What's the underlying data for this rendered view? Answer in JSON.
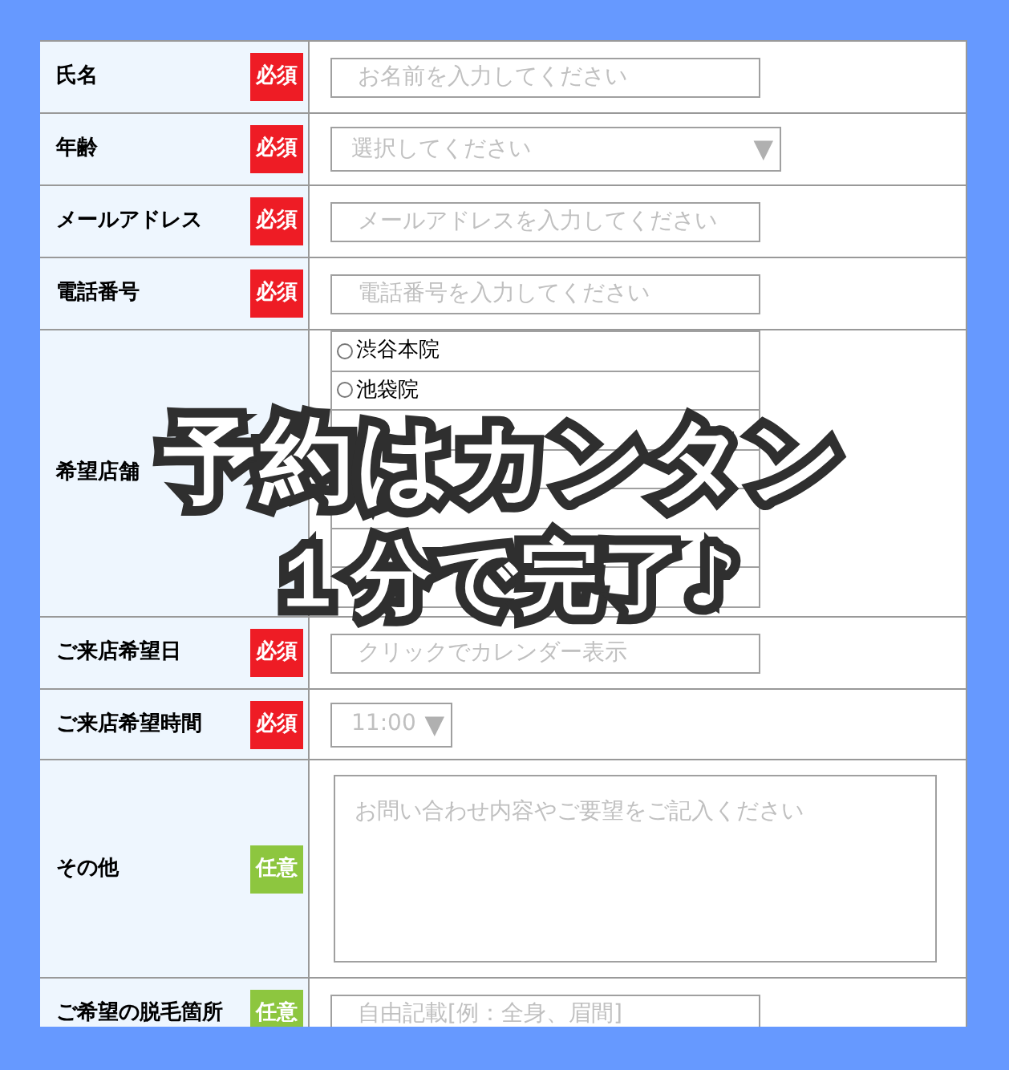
{
  "form": {
    "rows": [
      {
        "kind": "text",
        "label": "氏名",
        "badge": {
          "kind": "required",
          "text": "必須"
        },
        "placeholder": "お名前を入力してください"
      },
      {
        "kind": "select",
        "label": "年齢",
        "badge": {
          "kind": "required",
          "text": "必須"
        },
        "placeholder": "選択してください",
        "caret": "▼"
      },
      {
        "kind": "text",
        "label": "メールアドレス",
        "badge": {
          "kind": "required",
          "text": "必須"
        },
        "placeholder": "メールアドレスを入力してください"
      },
      {
        "kind": "text",
        "label": "電話番号",
        "badge": {
          "kind": "required",
          "text": "必須"
        },
        "placeholder": "電話番号を入力してください"
      },
      {
        "kind": "radio",
        "label": "希望店舗",
        "options": [
          {
            "kind": "radio",
            "label": "渋谷本院"
          },
          {
            "kind": "radio",
            "label": "池袋院"
          },
          {
            "kind": "blank"
          },
          {
            "kind": "blank"
          },
          {
            "kind": "blank"
          },
          {
            "kind": "blank"
          },
          {
            "kind": "blank"
          }
        ]
      },
      {
        "kind": "text",
        "label": "ご来店希望日",
        "badge": {
          "kind": "required",
          "text": "必須"
        },
        "placeholder": "クリックでカレンダー表示"
      },
      {
        "kind": "small-select",
        "label": "ご来店希望時間",
        "badge": {
          "kind": "required",
          "text": "必須"
        },
        "placeholder": "11:00",
        "caret": "▼"
      },
      {
        "kind": "textarea",
        "label": "その他",
        "badge": {
          "kind": "optional",
          "text": "任意"
        },
        "placeholder": "お問い合わせ内容やご要望をご記入ください"
      },
      {
        "kind": "text",
        "label": "ご希望の脱毛箇所",
        "badge": {
          "kind": "optional",
          "text": "任意"
        },
        "placeholder": "自由記載[例：全身、眉間]"
      }
    ]
  },
  "overlay": {
    "lines": [
      "予約はカンタン",
      "１分で完了♪"
    ]
  }
}
